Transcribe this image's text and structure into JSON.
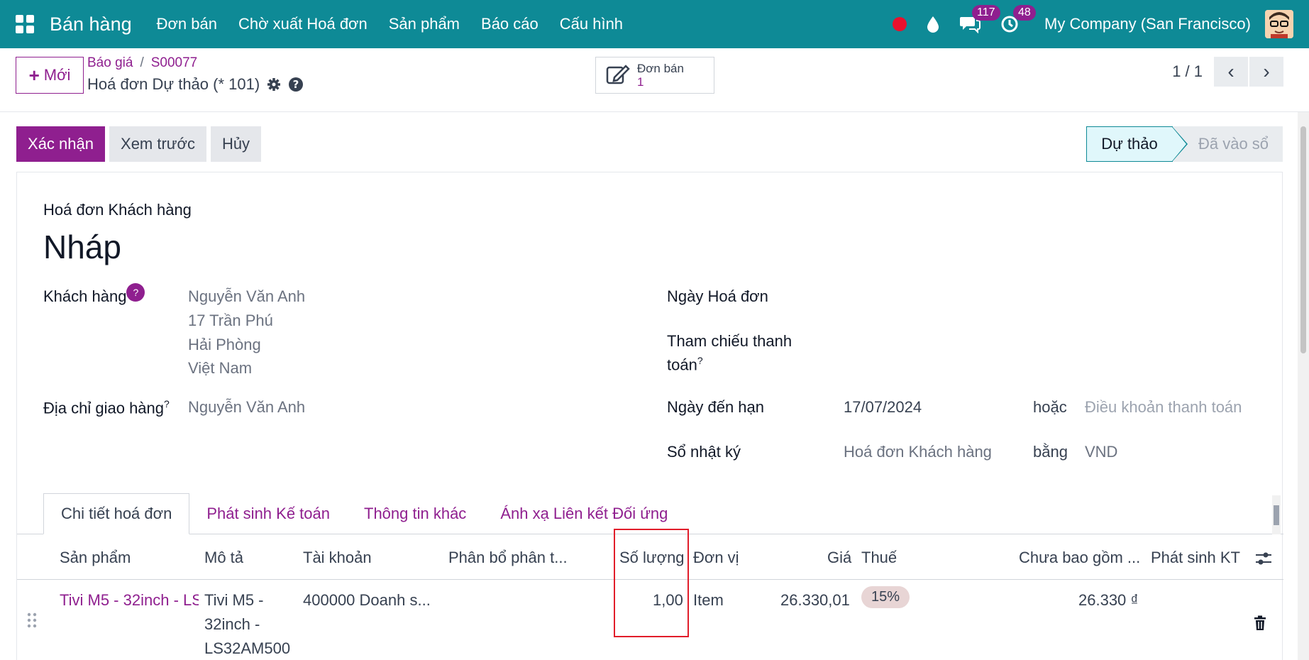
{
  "navbar": {
    "brand": "Bán hàng",
    "menu": [
      "Đơn bán",
      "Chờ xuất Hoá đơn",
      "Sản phẩm",
      "Báo cáo",
      "Cấu hình"
    ],
    "messages_count": "117",
    "activities_count": "48",
    "company": "My Company (San Francisco)"
  },
  "control": {
    "new_label": "Mới",
    "breadcrumb": [
      "Báo giá",
      "S00077"
    ],
    "record_title": "Hoá đơn Dự thảo (* 101)",
    "smart_button": {
      "label": "Đơn bán",
      "value": "1"
    },
    "pager": "1 / 1"
  },
  "actions": {
    "confirm": "Xác nhận",
    "preview": "Xem trước",
    "cancel": "Hủy"
  },
  "statusbar": {
    "current": "Dự thảo",
    "next": "Đã vào sổ"
  },
  "form": {
    "doc_type": "Hoá đơn Khách hàng",
    "name": "Nháp",
    "customer_label": "Khách hàng",
    "customer_lines": [
      "Nguyễn Văn Anh",
      "17 Trần Phú",
      "Hải Phòng",
      "Việt Nam"
    ],
    "delivery_label": "Địa chỉ giao hàng",
    "delivery_value": "Nguyễn Văn Anh",
    "invoice_date_label": "Ngày Hoá đơn",
    "payment_ref_label_1": "Tham chiếu thanh",
    "payment_ref_label_2": "toán",
    "due_date_label": "Ngày đến hạn",
    "due_date_value": "17/07/2024",
    "or_label": "hoặc",
    "payment_terms_placeholder": "Điều khoản thanh toán",
    "journal_label": "Sổ nhật ký",
    "journal_value": "Hoá đơn Khách hàng",
    "currency_in": "bằng",
    "currency_value": "VND"
  },
  "tabs": [
    "Chi tiết hoá đơn",
    "Phát sinh Kế toán",
    "Thông tin khác",
    "Ánh xạ Liên kết Đối ứng"
  ],
  "table": {
    "headers": {
      "product": "Sản phẩm",
      "description": "Mô tả",
      "account": "Tài khoản",
      "analytic": "Phân bổ phân t...",
      "quantity": "Số lượng",
      "uom": "Đơn vị",
      "price": "Giá",
      "tax": "Thuế",
      "subtotal": "Chưa bao gồm ...",
      "entries": "Phát sinh KT"
    },
    "rows": [
      {
        "product": "Tivi M5 - 32inch - LS",
        "description_lines": [
          "Tivi M5 -",
          "32inch -",
          "LS32AM500"
        ],
        "account": "400000 Doanh s...",
        "quantity": "1,00",
        "uom": "Item",
        "price": "26.330,01",
        "tax": "15%",
        "subtotal": "26.330 ₫"
      }
    ]
  }
}
